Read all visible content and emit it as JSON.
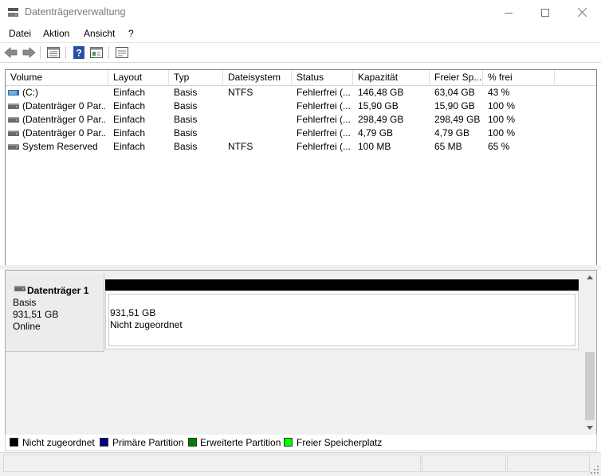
{
  "window": {
    "title": "Datenträgerverwaltung"
  },
  "menu": [
    "Datei",
    "Aktion",
    "Ansicht",
    "?"
  ],
  "toolbar": {
    "icons": [
      "back-arrow-icon",
      "forward-arrow-icon",
      "disk-list-icon",
      "help-icon",
      "properties-icon",
      "console-icon"
    ]
  },
  "volume_list": {
    "columns": [
      "Volume",
      "Layout",
      "Typ",
      "Dateisystem",
      "Status",
      "Kapazität",
      "Freier Sp...",
      "% frei"
    ],
    "rows": [
      {
        "volume": "(C:)",
        "layout": "Einfach",
        "typ": "Basis",
        "fs": "NTFS",
        "status": "Fehlerfrei (...",
        "capacity": "146,48 GB",
        "free": "63,04 GB",
        "pct": "43 %",
        "icon": "system-volume-icon"
      },
      {
        "volume": "(Datenträger 0 Par...",
        "layout": "Einfach",
        "typ": "Basis",
        "fs": "",
        "status": "Fehlerfrei (...",
        "capacity": "15,90 GB",
        "free": "15,90 GB",
        "pct": "100 %",
        "icon": "volume-icon"
      },
      {
        "volume": "(Datenträger 0 Par...",
        "layout": "Einfach",
        "typ": "Basis",
        "fs": "",
        "status": "Fehlerfrei (...",
        "capacity": "298,49 GB",
        "free": "298,49 GB",
        "pct": "100 %",
        "icon": "volume-icon"
      },
      {
        "volume": "(Datenträger 0 Par...",
        "layout": "Einfach",
        "typ": "Basis",
        "fs": "",
        "status": "Fehlerfrei (...",
        "capacity": "4,79 GB",
        "free": "4,79 GB",
        "pct": "100 %",
        "icon": "volume-icon"
      },
      {
        "volume": "System Reserved",
        "layout": "Einfach",
        "typ": "Basis",
        "fs": "NTFS",
        "status": "Fehlerfrei (...",
        "capacity": "100 MB",
        "free": "65 MB",
        "pct": "65 %",
        "icon": "volume-icon"
      }
    ]
  },
  "disk": {
    "name": "Datenträger 1",
    "type": "Basis",
    "size": "931,51 GB",
    "state": "Online",
    "partition": {
      "size": "931,51 GB",
      "label": "Nicht zugeordnet",
      "color": "#000000"
    }
  },
  "legend": [
    {
      "label": "Nicht zugeordnet",
      "color": "#000000"
    },
    {
      "label": "Primäre Partition",
      "color": "#000080"
    },
    {
      "label": "Erweiterte Partition",
      "color": "#008000"
    },
    {
      "label": "Freier Speicherplatz",
      "color": "#00ff00"
    }
  ]
}
